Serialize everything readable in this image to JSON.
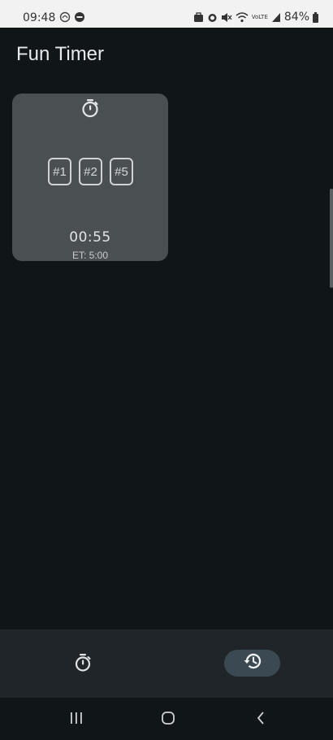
{
  "status_bar": {
    "time": "09:48",
    "battery_percent": "84%",
    "left_icons": [
      "app-notification-icon",
      "dnd-icon"
    ],
    "right_icons": [
      "work-profile-icon",
      "alarm-icon",
      "mute-icon",
      "wifi-icon",
      "volte-icon",
      "signal-icon",
      "battery-icon"
    ],
    "volte_label": "VoLTE"
  },
  "app": {
    "title": "Fun Timer"
  },
  "timer_card": {
    "icon": "stopwatch-icon",
    "badges": [
      "#1",
      "#2",
      "#5"
    ],
    "time": "00:55",
    "et_label": "ET: 5:00"
  },
  "bottom_nav": {
    "items": [
      {
        "icon": "stopwatch-icon",
        "selected": false
      },
      {
        "icon": "history-icon",
        "selected": true
      }
    ]
  },
  "system_nav": {
    "items": [
      "recents-icon",
      "home-icon",
      "back-icon"
    ]
  },
  "colors": {
    "background": "#101517",
    "card": "#4a4f52",
    "nav_bar": "#1f2528",
    "nav_selected_pill": "#3b4a52",
    "text_primary": "#e8eaec"
  }
}
